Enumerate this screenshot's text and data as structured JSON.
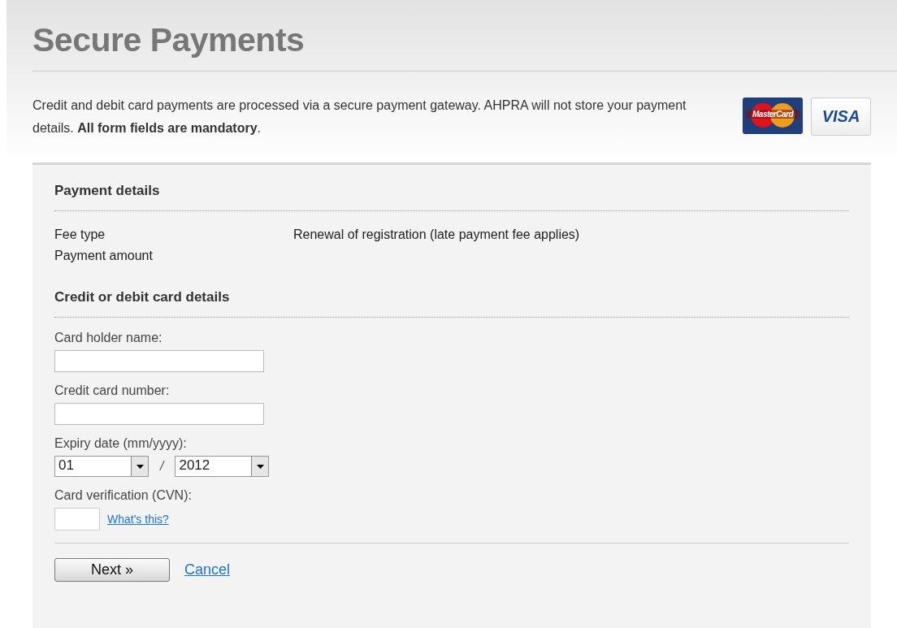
{
  "header": {
    "title": "Secure Payments"
  },
  "intro": {
    "text": "Credit and debit card payments are processed via a secure payment gateway. AHPRA will not store your payment details. **All form fields are mandatory**.",
    "logos": [
      {
        "kind": "mastercard",
        "label": "MasterCard"
      },
      {
        "kind": "visa",
        "label": "VISA"
      }
    ]
  },
  "payment_details": {
    "heading": "Payment details",
    "rows": [
      {
        "label": "Fee type",
        "value": "Renewal of registration (late payment fee applies)"
      },
      {
        "label": "Payment amount"
      }
    ]
  },
  "card_details": {
    "heading": "Credit or debit card details",
    "fields": [
      {
        "kind": "text",
        "label": "Card holder name:"
      },
      {
        "kind": "text",
        "label": "Credit card number:"
      },
      {
        "kind": "expiry",
        "label": "Expiry date (mm/yyyy):",
        "month": "01",
        "separator": "/",
        "year": "2012"
      },
      {
        "kind": "cvn",
        "label": "Card verification (CVN):",
        "link": "What's this?"
      }
    ]
  },
  "actions": {
    "next": "Next »",
    "cancel": "Cancel"
  }
}
